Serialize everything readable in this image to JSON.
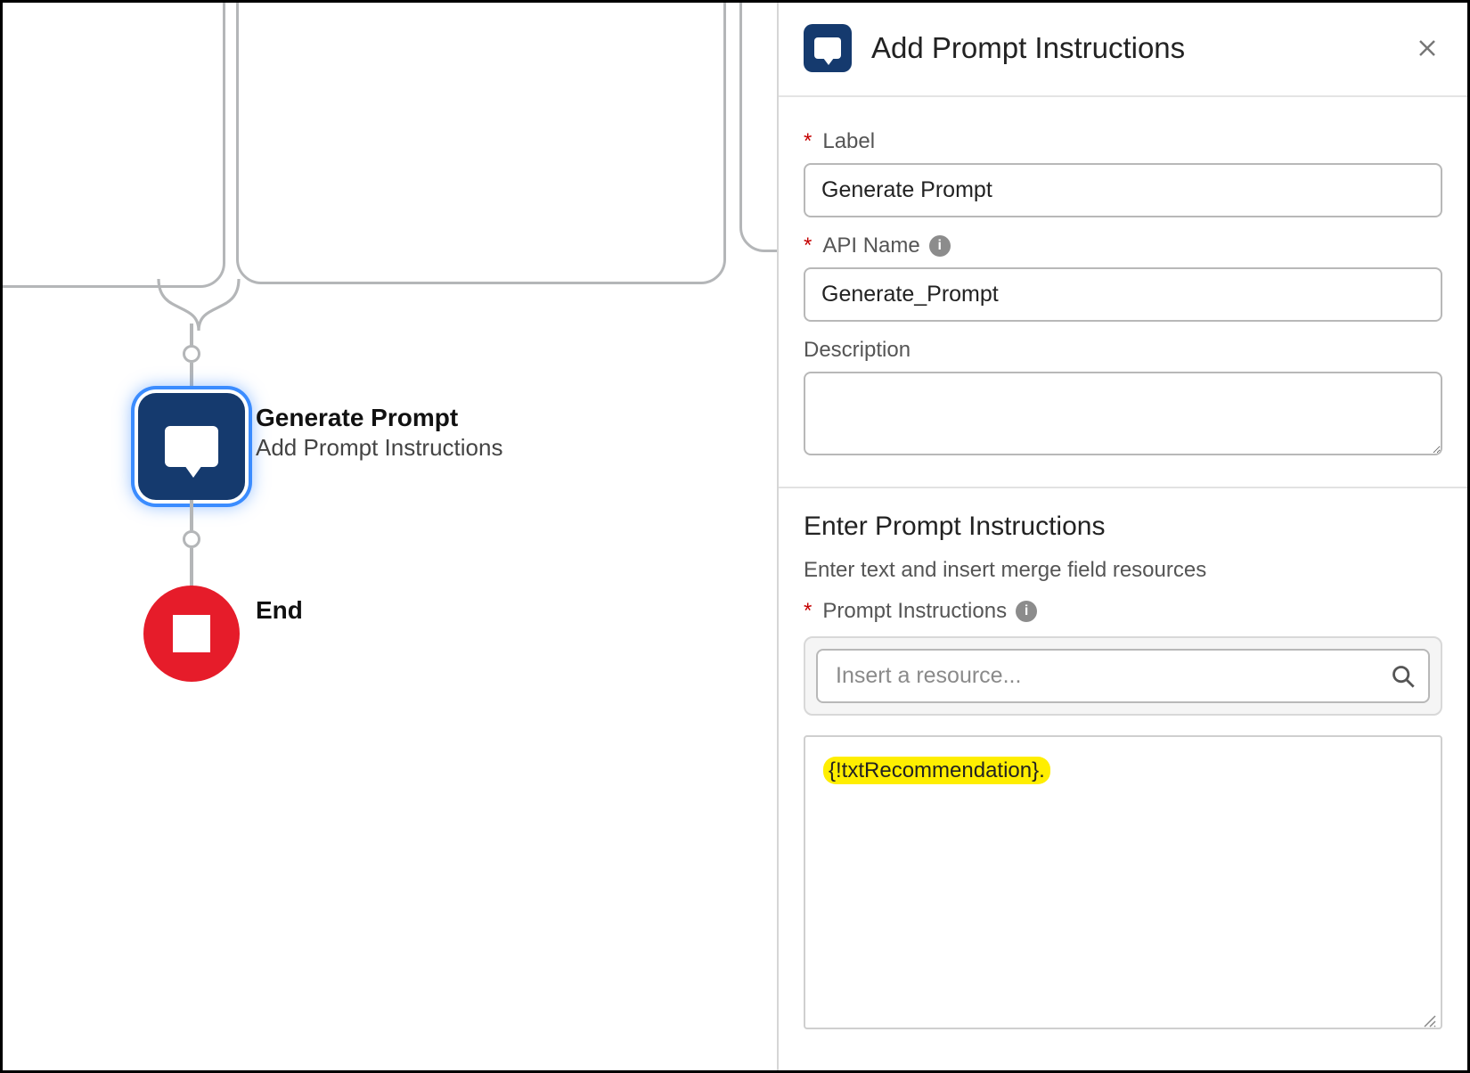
{
  "canvas": {
    "prompt_node": {
      "title": "Generate Prompt",
      "subtitle": "Add Prompt Instructions"
    },
    "end_node": {
      "label": "End"
    }
  },
  "panel": {
    "title": "Add Prompt Instructions",
    "fields": {
      "label_caption": "Label",
      "label_value": "Generate Prompt",
      "api_caption": "API Name",
      "api_value": "Generate_Prompt",
      "desc_caption": "Description",
      "desc_value": ""
    },
    "section": {
      "heading": "Enter Prompt Instructions",
      "help": "Enter text and insert merge field resources",
      "field_caption": "Prompt Instructions",
      "resource_placeholder": "Insert a resource...",
      "content": "{!txtRecommendation}."
    }
  }
}
